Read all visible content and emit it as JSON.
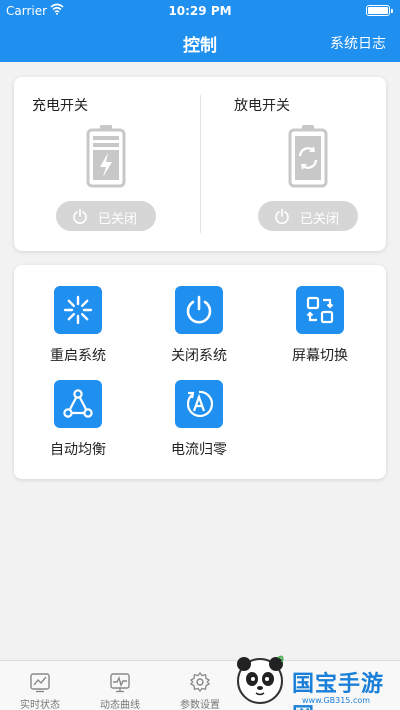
{
  "status_bar": {
    "carrier": "Carrier",
    "time": "10:29 PM"
  },
  "nav": {
    "title": "控制",
    "right_link": "系统日志"
  },
  "switches": [
    {
      "title": "充电开关",
      "state": "已关闭",
      "icon": "battery-charging-icon"
    },
    {
      "title": "放电开关",
      "state": "已关闭",
      "icon": "battery-refresh-icon"
    }
  ],
  "functions": [
    {
      "label": "重启系统",
      "icon": "loading-spinner-icon"
    },
    {
      "label": "关闭系统",
      "icon": "power-icon"
    },
    {
      "label": "屏幕切换",
      "icon": "screen-switch-icon"
    },
    {
      "label": "自动均衡",
      "icon": "triangle-nodes-icon"
    },
    {
      "label": "电流归零",
      "icon": "ammeter-reset-icon"
    }
  ],
  "tabs": [
    {
      "label": "实时状态",
      "icon": "realtime-chart-icon"
    },
    {
      "label": "动态曲线",
      "icon": "curve-monitor-icon"
    },
    {
      "label": "参数设置",
      "icon": "gear-icon"
    }
  ],
  "watermark": {
    "brand": "国宝手游网",
    "url": "www.GB315.com"
  },
  "colors": {
    "accent": "#1f8ff0",
    "pill_off": "#d6d6d6",
    "icon_gray": "#c8c8c8"
  }
}
